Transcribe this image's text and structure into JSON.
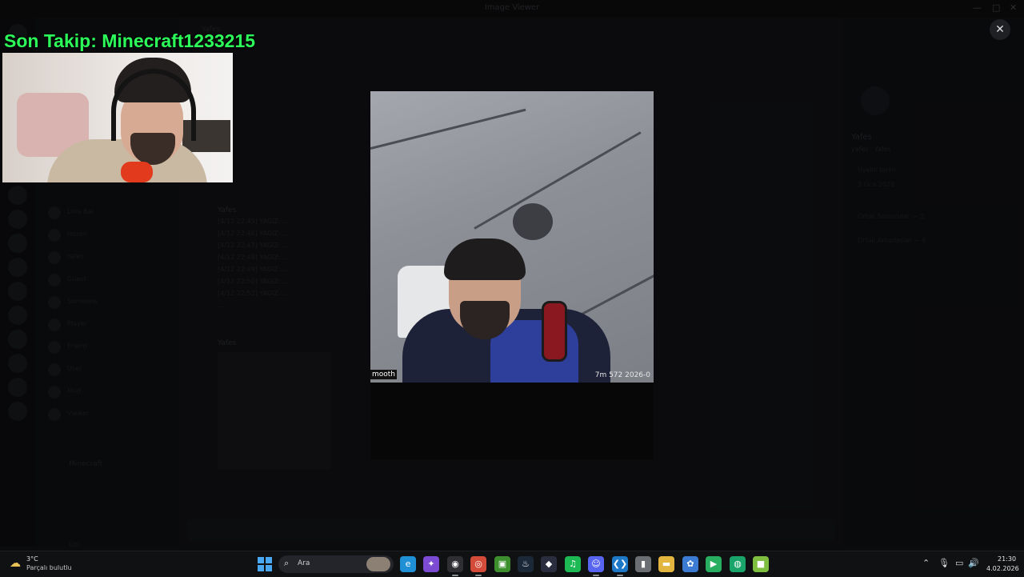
{
  "app": {
    "window_title": "Image Viewer",
    "channel_header": "Yafes",
    "dm_list": [
      {
        "name": "Lora Bal"
      },
      {
        "name": "Hozen"
      },
      {
        "name": "Yafes"
      },
      {
        "name": "Guest"
      },
      {
        "name": "Someone"
      },
      {
        "name": "Player"
      },
      {
        "name": "Friend"
      },
      {
        "name": "User"
      },
      {
        "name": "Mod"
      },
      {
        "name": "Viewer"
      }
    ],
    "voice_channel": "Minecraft",
    "user_panel_name": "Ünl",
    "chat_author_1": "Yafes",
    "chat_author_2": "Yafes",
    "chat_lines": [
      "[4/12 22:45] YAGIZ: ...",
      "[4/12 22:46] YAGIZ: ...",
      "[4/12 22:47] YAGIZ: ...",
      "[4/12 22:48] YAGIZ: ...",
      "[4/12 22:49] YAGIZ: ...",
      "[4/12 22:50] YAGIZ: ...",
      "[4/12 22:52] YAGIZ: ...",
      "..."
    ],
    "profile": {
      "name": "Yafes",
      "subtitle": "yafes · Yafes",
      "member_since_label": "Üyelik tarihi",
      "member_since_date": "3 Oca 2020",
      "mutual_servers": "Ortak Sunucular — 2",
      "mutual_friends": "Ortak Arkadaşlar — 6"
    }
  },
  "stream_overlay": {
    "follow_text": "Son Takip: Minecraft1233215"
  },
  "viewer": {
    "caption_left": "mooth",
    "caption_right": "7m 572  2026-0",
    "close_icon": "✕"
  },
  "taskbar": {
    "weather_temp": "3°C",
    "weather_desc": "Parçalı bulutlu",
    "search_label": "Ara",
    "clock_time": "21:30",
    "clock_date": "4.02.2026",
    "apps": [
      {
        "name": "edge",
        "glyph": "e",
        "color": "#1f8fd6"
      },
      {
        "name": "copilot",
        "glyph": "✦",
        "color": "#7b4bd3"
      },
      {
        "name": "obs",
        "glyph": "◉",
        "color": "#2e2e33"
      },
      {
        "name": "chrome",
        "glyph": "◎",
        "color": "#d44b3a"
      },
      {
        "name": "minecraft",
        "glyph": "▣",
        "color": "#3d8f2e"
      },
      {
        "name": "steam",
        "glyph": "♨",
        "color": "#1b2838"
      },
      {
        "name": "app-dark",
        "glyph": "◆",
        "color": "#2a2d3e"
      },
      {
        "name": "spotify",
        "glyph": "♫",
        "color": "#1db954"
      },
      {
        "name": "discord",
        "glyph": "☺",
        "color": "#5865f2"
      },
      {
        "name": "vscode",
        "glyph": "❮❯",
        "color": "#1e78c8"
      },
      {
        "name": "usb-app",
        "glyph": "▮",
        "color": "#6b6e73"
      },
      {
        "name": "file-explorer",
        "glyph": "▬",
        "color": "#e2b53e"
      },
      {
        "name": "network-app",
        "glyph": "✿",
        "color": "#3b7bd4"
      },
      {
        "name": "play-app",
        "glyph": "▶",
        "color": "#27ae60"
      },
      {
        "name": "radar-app",
        "glyph": "◍",
        "color": "#19a56a"
      },
      {
        "name": "cube-app",
        "glyph": "■",
        "color": "#7fbf3f"
      }
    ],
    "tray": {
      "chevron": "⌃",
      "mic": "🎙",
      "display": "▭",
      "volume": "🔊",
      "battery": "▯"
    }
  }
}
